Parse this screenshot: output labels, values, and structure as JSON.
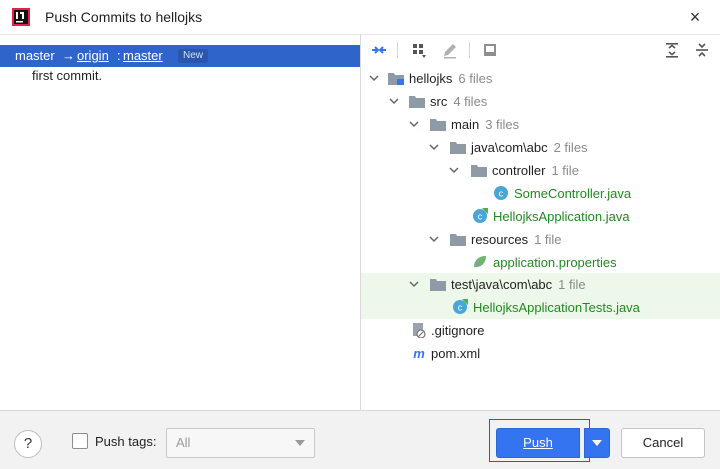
{
  "window": {
    "title": "Push Commits to hellojks",
    "close_label": "×"
  },
  "left_panel": {
    "branch": {
      "local": "master",
      "arrow": "→",
      "remote": "origin",
      "sep": ":",
      "remote_branch": "master",
      "badge": "New"
    },
    "commits": [
      "first commit."
    ]
  },
  "toolbar": {
    "icons": [
      "expand-arrows-icon",
      "group-by-icon",
      "edit-icon",
      "show-diff-icon",
      "expand-all-icon",
      "collapse-all-icon"
    ]
  },
  "tree": {
    "root": {
      "name": "hellojks",
      "count": "6 files"
    },
    "src": {
      "name": "src",
      "count": "4 files"
    },
    "main": {
      "name": "main",
      "count": "3 files"
    },
    "pkg": {
      "name": "java\\com\\abc",
      "count": "2 files"
    },
    "controller": {
      "name": "controller",
      "count": "1 file"
    },
    "some_controller": "SomeController.java",
    "hellojks_app": "HellojksApplication.java",
    "resources": {
      "name": "resources",
      "count": "1 file"
    },
    "app_props": "application.properties",
    "test_pkg": {
      "name": "test\\java\\com\\abc",
      "count": "1 file"
    },
    "app_tests": "HellojksApplicationTests.java",
    "gitignore": ".gitignore",
    "pom": "pom.xml"
  },
  "bottom": {
    "help": "?",
    "push_tags_label": "Push tags:",
    "tags_select_value": "All",
    "push_label": "Push",
    "cancel_label": "Cancel"
  },
  "colors": {
    "selection": "#2f65ca",
    "accent": "#3574f0",
    "new_file": "#1f8a1f",
    "highlight": "#e31c1c"
  }
}
